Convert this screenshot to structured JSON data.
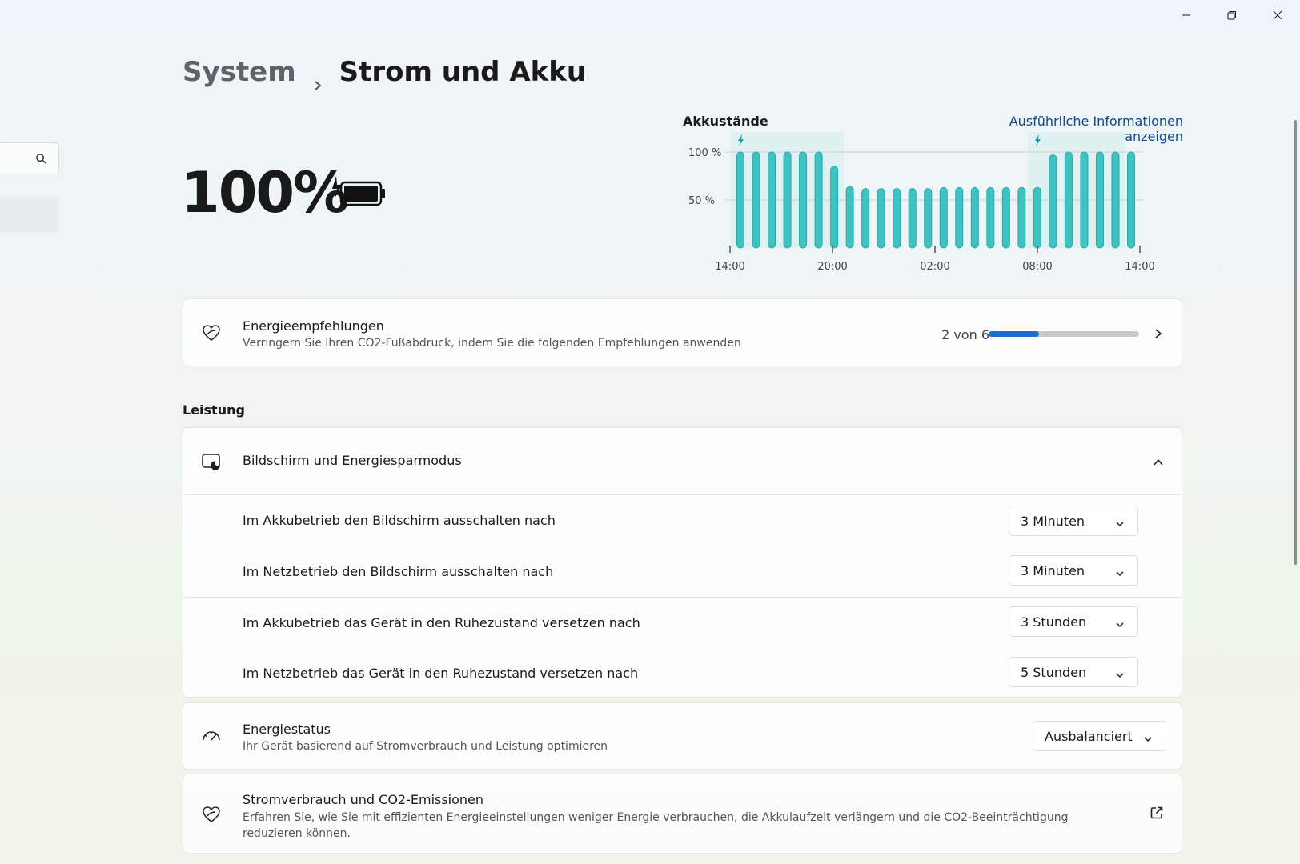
{
  "breadcrumb": {
    "parent": "System",
    "current": "Strom und Akku"
  },
  "battery": {
    "percent": "100%",
    "charging": true
  },
  "chart_data": {
    "type": "bar",
    "title": "Akkustände",
    "link": "Ausführliche Informationen anzeigen",
    "x_ticks": [
      "14:00",
      "20:00",
      "02:00",
      "08:00",
      "14:00"
    ],
    "y_ticks": [
      "100 %",
      "50 %"
    ],
    "ylim": [
      0,
      100
    ],
    "values": [
      100,
      100,
      100,
      100,
      100,
      100,
      85,
      64,
      62,
      62,
      62,
      62,
      62,
      63,
      63,
      63,
      63,
      63,
      63,
      63,
      97,
      100,
      100,
      100,
      100,
      100
    ],
    "charging_segments": [
      [
        0,
        6
      ],
      [
        19,
        24
      ]
    ],
    "bar_color": "#3cc4c4"
  },
  "recommendations": {
    "title": "Energieempfehlungen",
    "subtitle": "Verringern Sie Ihren CO2-Fußabdruck, indem Sie die folgenden Empfehlungen anwenden",
    "progress_label": "2 von 6",
    "progress_fraction": 0.333
  },
  "section": {
    "label": "Leistung"
  },
  "screen_sleep": {
    "title": "Bildschirm und Energiesparmodus",
    "rows": [
      {
        "label": "Im Akkubetrieb den Bildschirm ausschalten nach",
        "value": "3 Minuten"
      },
      {
        "label": "Im Netzbetrieb den Bildschirm ausschalten nach",
        "value": "3 Minuten"
      },
      {
        "label": "Im Akkubetrieb das Gerät in den Ruhezustand versetzen nach",
        "value": "3 Stunden"
      },
      {
        "label": "Im Netzbetrieb das Gerät in den Ruhezustand versetzen nach",
        "value": "5 Stunden"
      }
    ]
  },
  "power_mode": {
    "title": "Energiestatus",
    "subtitle": "Ihr Gerät basierend auf Stromverbrauch und Leistung optimieren",
    "value": "Ausbalanciert"
  },
  "emissions": {
    "title": "Stromverbrauch und CO2-Emissionen",
    "subtitle": "Erfahren Sie, wie Sie mit effizienten Energieeinstellungen weniger Energie verbrauchen, die Akkulaufzeit verlängern und die CO2-Beeinträchtigung reduzieren können."
  },
  "colors": {
    "accent": "#1b6fc7",
    "link": "#0a4a9a",
    "bar": "#3cc4c4"
  }
}
